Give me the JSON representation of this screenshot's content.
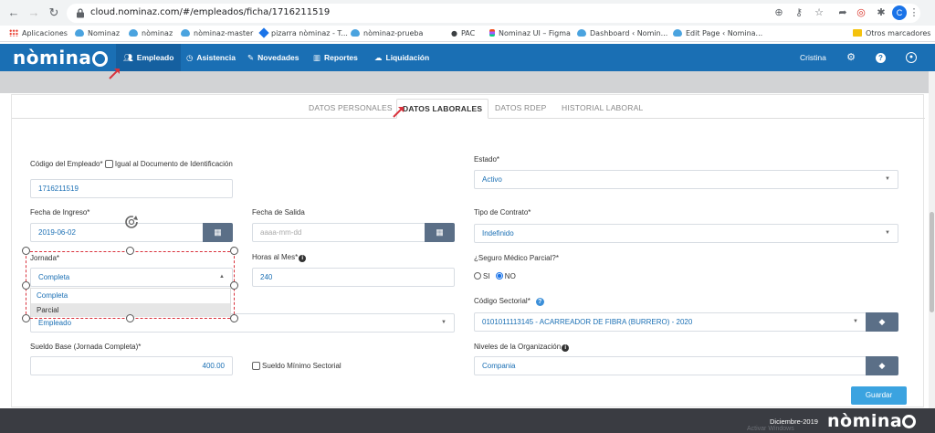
{
  "browser": {
    "url": "cloud.nominaz.com/#/empleados/ficha/1716211519",
    "avatar_letter": "C",
    "bookmarks": [
      {
        "label": "Aplicaciones",
        "icon": "apps-grid-icon"
      },
      {
        "label": "Nominaz",
        "icon": "cloud-icon"
      },
      {
        "label": "nòminaz",
        "icon": "cloud-icon"
      },
      {
        "label": "nòminaz-master",
        "icon": "cloud-icon"
      },
      {
        "label": "pizarra nòminaz - T...",
        "icon": "diamond-icon"
      },
      {
        "label": "nòminaz-prueba",
        "icon": "cloud-icon"
      },
      {
        "label": "PAC",
        "icon": "github-icon"
      },
      {
        "label": "Nominaz UI – Figma",
        "icon": "figma-icon"
      },
      {
        "label": "Dashboard ‹ Nomin...",
        "icon": "cloud-icon"
      },
      {
        "label": "Edit Page ‹ Nomina...",
        "icon": "cloud-icon"
      },
      {
        "label": "Otros marcadores",
        "icon": "folder-icon"
      }
    ]
  },
  "header": {
    "logo": "nòminaz",
    "menu": [
      {
        "label": "Empleado",
        "icon": "users-icon",
        "active": true
      },
      {
        "label": "Asistencia",
        "icon": "clock-icon",
        "active": false
      },
      {
        "label": "Novedades",
        "icon": "edit-icon",
        "active": false
      },
      {
        "label": "Reportes",
        "icon": "bar-chart-icon",
        "active": false
      },
      {
        "label": "Liquidación",
        "icon": "cloud-upload-icon",
        "active": false
      }
    ],
    "user": "Cristina"
  },
  "tabs": [
    {
      "label": "DATOS PERSONALES",
      "active": false
    },
    {
      "label": "DATOS LABORALES",
      "active": true
    },
    {
      "label": "DATOS RDEP",
      "active": false
    },
    {
      "label": "HISTORIAL LABORAL",
      "active": false
    }
  ],
  "form": {
    "codigo_label": "Código del Empleado*",
    "igual_label": "Igual al Documento de Identificación",
    "codigo_value": "1716211519",
    "estado_label": "Estado*",
    "estado_value": "Activo",
    "fecha_ingreso_label": "Fecha de Ingreso*",
    "fecha_ingreso_value": "2019-06-02",
    "fecha_salida_label": "Fecha de Salida",
    "fecha_salida_placeholder": "aaaa-mm-dd",
    "tipo_contrato_label": "Tipo de Contrato*",
    "tipo_contrato_value": "Indefinido",
    "jornada_label": "Jornada*",
    "jornada_value": "Completa",
    "jornada_options": [
      "Completa",
      "Parcial"
    ],
    "horas_label": "Horas al Mes*",
    "horas_value": "240",
    "seguro_label": "¿Seguro Médico Parcial?*",
    "seguro_si": "SI",
    "seguro_no": "NO",
    "tipo_empleado_value": "Empleado",
    "codigo_sectorial_label": "Código Sectorial*",
    "codigo_sectorial_value": "0101011113145 - ACARREADOR DE FIBRA (BURRERO) - 2020",
    "sueldo_label": "Sueldo Base (Jornada Completa)*",
    "sueldo_value": "400.00",
    "sueldo_minimo_label": "Sueldo Mínimo Sectorial",
    "niveles_label": "Niveles de la Organización",
    "niveles_value": "Compania",
    "save_label": "Guardar"
  },
  "footer": {
    "date": "Diciembre-2019",
    "logo": "nòminaz",
    "ghost_text": "Activar Windows"
  },
  "colors": {
    "header_blue": "#1a6fb4",
    "active_menu": "#1560a0",
    "save_button": "#3ba3e0",
    "addon_button": "#5b6f87",
    "selection_dash": "#d9323c",
    "footer_bg": "#3a3c42"
  }
}
